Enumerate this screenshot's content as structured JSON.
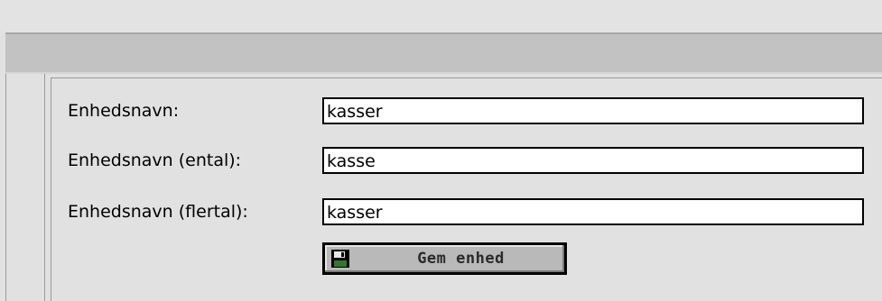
{
  "form": {
    "fields": [
      {
        "label": "Enhedsnavn:",
        "value": "kasser"
      },
      {
        "label": "Enhedsnavn (ental):",
        "value": "kasse"
      },
      {
        "label": "Enhedsnavn (flertal):",
        "value": "kasser"
      }
    ],
    "save_button": {
      "label": "Gem enhed",
      "icon": "floppy-disk-icon"
    }
  }
}
